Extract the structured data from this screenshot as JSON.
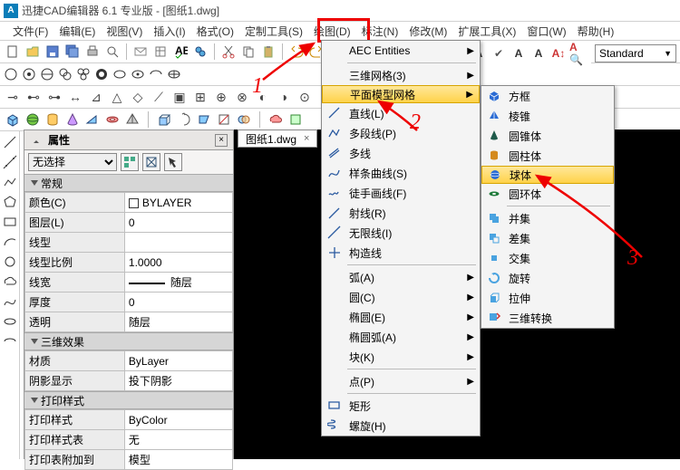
{
  "title": "迅捷CAD编辑器 6.1 专业版 - [图纸1.dwg]",
  "app_icon_letter": "A",
  "menu": {
    "file": "文件(F)",
    "edit": "编辑(E)",
    "view": "视图(V)",
    "insert": "插入(I)",
    "format": "格式(O)",
    "custom": "定制工具(S)",
    "draw": "绘图(D)",
    "annotate": "标注(N)",
    "modify": "修改(M)",
    "ext": "扩展工具(X)",
    "window": "窗口(W)",
    "help": "帮助(H)"
  },
  "style_combo": "Standard",
  "doc_tab": "图纸1.dwg",
  "props": {
    "title": "属性",
    "no_select": "无选择",
    "sec_general": "常规",
    "sec_3d": "三维效果",
    "sec_print": "打印样式",
    "rows_general": [
      {
        "k": "颜色(C)",
        "v": "BYLAYER",
        "swatch": true
      },
      {
        "k": "图层(L)",
        "v": "0"
      },
      {
        "k": "线型",
        "v": ""
      },
      {
        "k": "线型比例",
        "v": "1.0000"
      },
      {
        "k": "线宽",
        "v": "随层",
        "line": true
      },
      {
        "k": "厚度",
        "v": "0"
      },
      {
        "k": "透明",
        "v": "随层"
      }
    ],
    "rows_3d": [
      {
        "k": "材质",
        "v": "ByLayer"
      },
      {
        "k": "阴影显示",
        "v": "投下阴影"
      }
    ],
    "rows_print": [
      {
        "k": "打印样式",
        "v": "ByColor"
      },
      {
        "k": "打印样式表",
        "v": "无"
      },
      {
        "k": "打印表附加到",
        "v": "模型"
      }
    ]
  },
  "menu1": [
    {
      "label": "AEC Entities",
      "sub": true
    },
    {
      "sep": true
    },
    {
      "label": "三维网格(3)",
      "sub": true
    },
    {
      "label": "平面模型网格",
      "sub": true,
      "hl": true
    },
    {
      "label": "直线(L)",
      "icon": "line"
    },
    {
      "label": "多段线(P)",
      "icon": "pline"
    },
    {
      "label": "多线",
      "icon": "mline"
    },
    {
      "label": "样条曲线(S)",
      "icon": "spline"
    },
    {
      "label": "徒手画线(F)",
      "icon": "free"
    },
    {
      "label": "射线(R)",
      "icon": "ray"
    },
    {
      "label": "无限线(I)",
      "icon": "xline"
    },
    {
      "label": "构造线",
      "icon": "cons"
    },
    {
      "sep": true
    },
    {
      "label": "弧(A)",
      "sub": true
    },
    {
      "label": "圆(C)",
      "sub": true
    },
    {
      "label": "椭圆(E)",
      "sub": true
    },
    {
      "label": "椭圆弧(A)",
      "sub": true
    },
    {
      "label": "块(K)",
      "sub": true
    },
    {
      "sep": true
    },
    {
      "label": "点(P)",
      "sub": true
    },
    {
      "sep": true
    },
    {
      "label": "矩形",
      "icon": "rect"
    },
    {
      "label": "螺旋(H)",
      "icon": "helix"
    }
  ],
  "menu2": [
    {
      "label": "方框",
      "icon": "box"
    },
    {
      "label": "棱锥",
      "icon": "pyra"
    },
    {
      "label": "圆锥体",
      "icon": "cone"
    },
    {
      "label": "圆柱体",
      "icon": "cyl"
    },
    {
      "label": "球体",
      "icon": "sphere",
      "hl": true
    },
    {
      "label": "圆环体",
      "icon": "torus"
    },
    {
      "sep": true
    },
    {
      "label": "并集",
      "icon": "union"
    },
    {
      "label": "差集",
      "icon": "sub"
    },
    {
      "label": "交集",
      "icon": "inter"
    },
    {
      "label": "旋转",
      "icon": "rev"
    },
    {
      "label": "拉伸",
      "icon": "ext"
    },
    {
      "label": "三维转换",
      "icon": "conv3d"
    }
  ],
  "anno": {
    "a1": "1",
    "a2": "2",
    "a3": "3"
  }
}
